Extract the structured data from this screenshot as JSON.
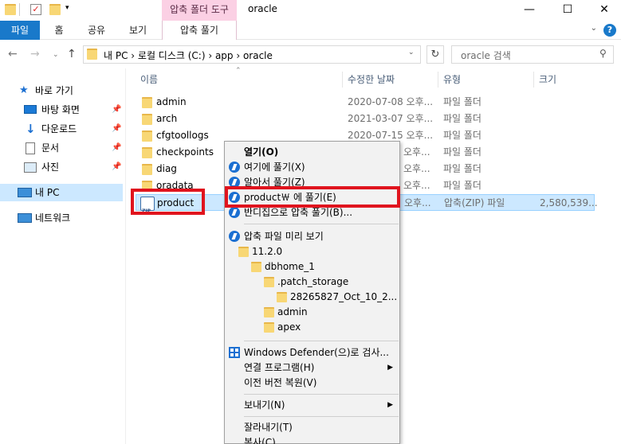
{
  "window": {
    "contextual_tab": "압축 폴더 도구",
    "title": "oracle",
    "minimize": "—",
    "maximize": "☐",
    "close": "✕"
  },
  "ribbon": {
    "file": "파일",
    "home": "홈",
    "share": "공유",
    "view": "보기",
    "extract": "압축 풀기",
    "help": "?"
  },
  "address": {
    "path": "내 PC  ›  로컬 디스크 (C:)  ›  app  ›  oracle",
    "search_placeholder": "oracle 검색"
  },
  "sidebar": {
    "quick_access": "바로 가기",
    "items": [
      {
        "label": "바탕 화면"
      },
      {
        "label": "다운로드"
      },
      {
        "label": "문서"
      },
      {
        "label": "사진"
      }
    ],
    "this_pc": "내 PC",
    "network": "네트워크"
  },
  "columns": {
    "name": "이름",
    "modified": "수정한 날짜",
    "type": "유형",
    "size": "크기"
  },
  "files": [
    {
      "name": "admin",
      "date": "2020-07-08 오후...",
      "type": "파일 폴더",
      "size": ""
    },
    {
      "name": "arch",
      "date": "2021-03-07 오후...",
      "type": "파일 폴더",
      "size": ""
    },
    {
      "name": "cfgtoollogs",
      "date": "2020-07-15 오후...",
      "type": "파일 폴더",
      "size": ""
    },
    {
      "name": "checkpoints",
      "date": "오후...",
      "type": "파일 폴더",
      "size": ""
    },
    {
      "name": "diag",
      "date": "오후...",
      "type": "파일 폴더",
      "size": ""
    },
    {
      "name": "oradata",
      "date": "오후...",
      "type": "파일 폴더",
      "size": ""
    },
    {
      "name": "product",
      "date": "오후...",
      "type": "압축(ZIP) 파일",
      "size": "2,580,539..."
    }
  ],
  "menu": {
    "open": "열기(O)",
    "extract_here": "여기에 풀기(X)",
    "extract_alzip": "알아서 풀기(Z)",
    "extract_to": "product￦ 에 풀기(E)",
    "extract_bandizip": "반디집으로 압축 풀기(B)...",
    "preview": "압축 파일 미리 보기",
    "tree": [
      {
        "label": "11.2.0"
      },
      {
        "label": "dbhome_1"
      },
      {
        "label": ".patch_storage"
      },
      {
        "label": "28265827_Oct_10_2..."
      },
      {
        "label": "admin"
      },
      {
        "label": "apex"
      }
    ],
    "defender": "Windows Defender(으)로 검사...",
    "open_with": "연결 프로그램(H)",
    "restore": "이전 버전 복원(V)",
    "send_to": "보내기(N)",
    "cut": "잘라내기(T)",
    "copy": "복사(C)"
  }
}
